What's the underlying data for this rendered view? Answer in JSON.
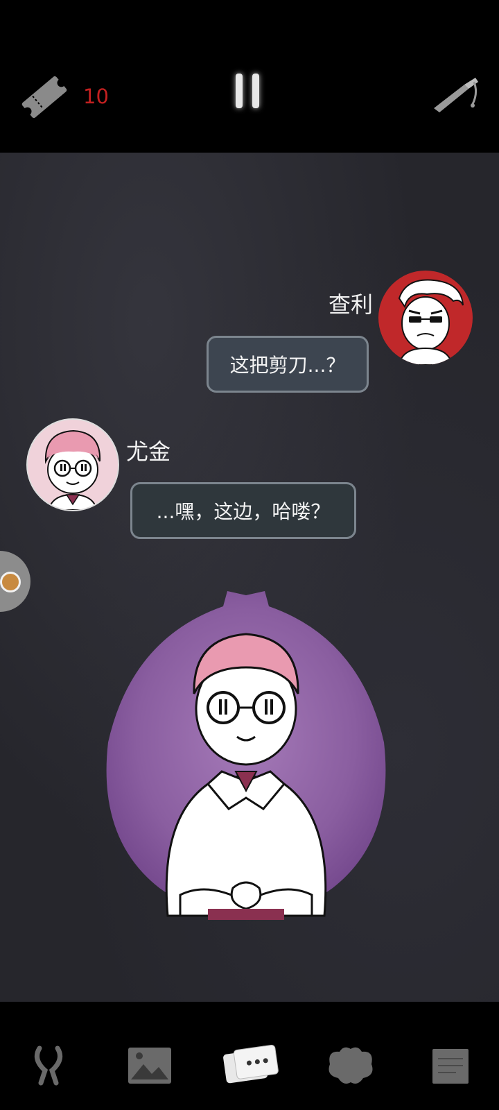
{
  "header": {
    "ticket_count": "10",
    "icons": {
      "ticket": "ticket-icon",
      "pause": "pause-icon",
      "knife": "knife-icon"
    }
  },
  "chat": {
    "messages": [
      {
        "speaker": "查利",
        "text": "这把剪刀...？",
        "side": "right"
      },
      {
        "speaker": "尤金",
        "text": "...嘿，这边，哈喽？",
        "side": "left"
      }
    ]
  },
  "nav": {
    "items": [
      {
        "icon": "scissors-icon",
        "active": false
      },
      {
        "icon": "gallery-icon",
        "active": false
      },
      {
        "icon": "chat-cards-icon",
        "active": true
      },
      {
        "icon": "creature-icon",
        "active": false
      },
      {
        "icon": "notes-icon",
        "active": false
      }
    ]
  },
  "colors": {
    "ticket_count": "#c42020",
    "charlie_avatar_bg": "#c0282a",
    "eugene_avatar_bg": "#f0d2da",
    "bubble_bg": "#3d4550",
    "stage_bg": "#26262c"
  }
}
